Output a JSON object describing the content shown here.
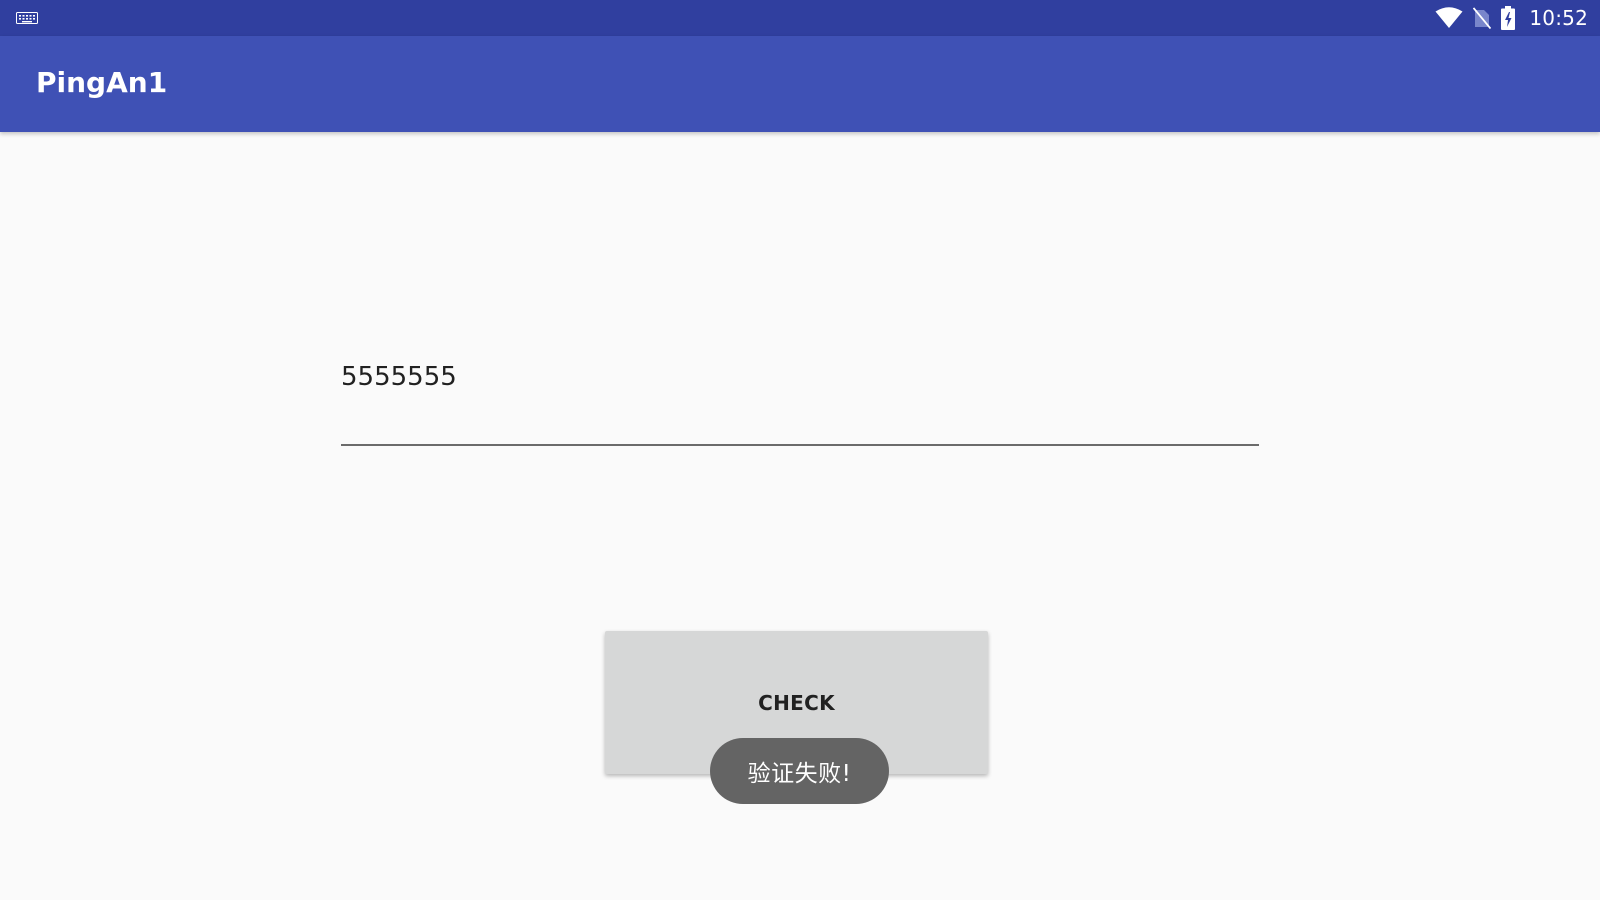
{
  "status_bar": {
    "time": "10:52",
    "icons": [
      "keyboard-icon",
      "wifi-icon",
      "no-sim-icon",
      "battery-charging-icon"
    ],
    "color": "#303f9f"
  },
  "app_bar": {
    "title": "PingAn1",
    "color": "#3f51b5"
  },
  "form": {
    "input_value": "5555555",
    "check_button_label": "CHECK"
  },
  "toast": {
    "message": "验证失败!"
  }
}
